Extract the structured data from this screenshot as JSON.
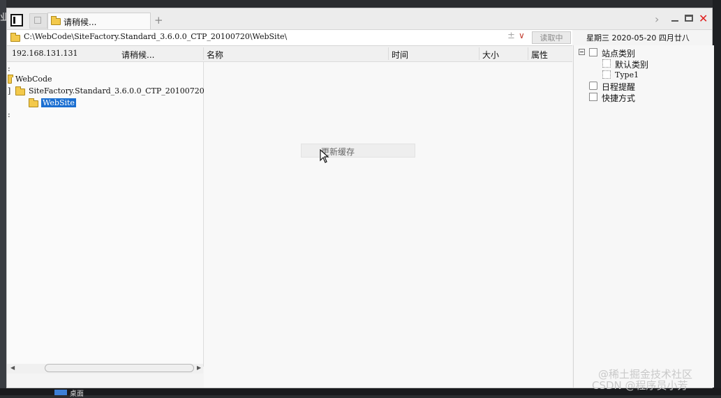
{
  "desktop": {
    "left_glyph": "业",
    "taskbar_label": "桌面"
  },
  "window": {
    "tab_title": "请稍候...",
    "new_tab_symbol": "+",
    "address": "C:\\WebCode\\SiteFactory.Standard_3.6.0.0_CTP_20100720\\WebSite\\",
    "address_pin_symbol": "±",
    "address_dropdown_symbol": "∨",
    "read_button": "读取中",
    "date_line": "星期三  2020-05-20  四月廿八"
  },
  "header": {
    "host": "192.168.131.131",
    "status": "请稍候...",
    "columns": [
      "名称",
      "时间",
      "大小",
      "属性"
    ]
  },
  "tree": {
    "root_colon": ":",
    "items": [
      "WebCode",
      "SiteFactory.Standard_3.6.0.0_CTP_20100720",
      "WebSite"
    ],
    "trailing_colon": ":"
  },
  "context_menu": {
    "item": "更新缓存"
  },
  "right_panel": {
    "site_categories": "站点类别",
    "default_category": "默认类别",
    "type_item": "Type1",
    "schedule": "日程提醒",
    "shortcuts": "快捷方式"
  },
  "watermarks": {
    "line1": "@稀土掘金技术社区",
    "line2": "CSDN @程序员小芳"
  }
}
